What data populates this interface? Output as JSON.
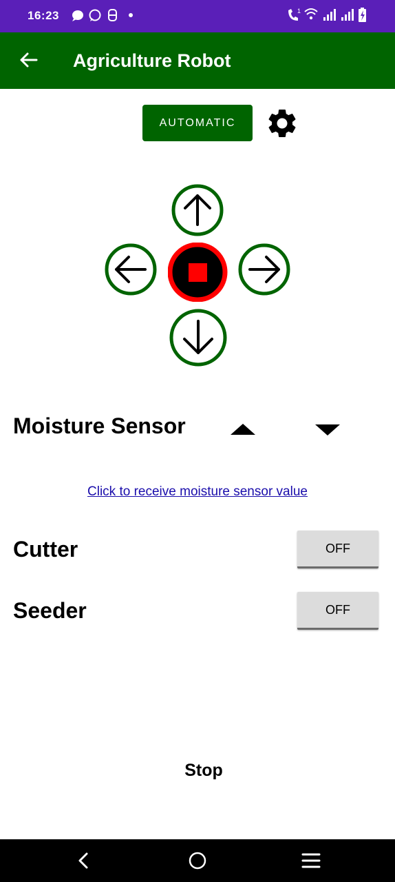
{
  "status_bar": {
    "time": "16:23",
    "icons": [
      "message-icon",
      "whatsapp-icon",
      "app-icon",
      "dot-icon",
      "wifi-call-icon",
      "wifi-icon",
      "signal-icon",
      "signal-icon",
      "battery-charging-icon"
    ]
  },
  "app_bar": {
    "title": "Agriculture Robot",
    "back_icon": "arrow-left-icon"
  },
  "controls": {
    "auto_label": "AUTOMATIC",
    "settings_icon": "gear-icon",
    "colors": {
      "green": "#006400",
      "red": "#ff0000"
    }
  },
  "moisture": {
    "title": "Moisture Sensor",
    "link_text": "Click to receive moisture sensor value"
  },
  "cutter": {
    "label": "Cutter",
    "state": "OFF"
  },
  "seeder": {
    "label": "Seeder",
    "state": "OFF"
  },
  "status_text": "Stop",
  "nav_bar": {
    "icons": [
      "back-nav-icon",
      "home-nav-icon",
      "menu-nav-icon"
    ]
  }
}
